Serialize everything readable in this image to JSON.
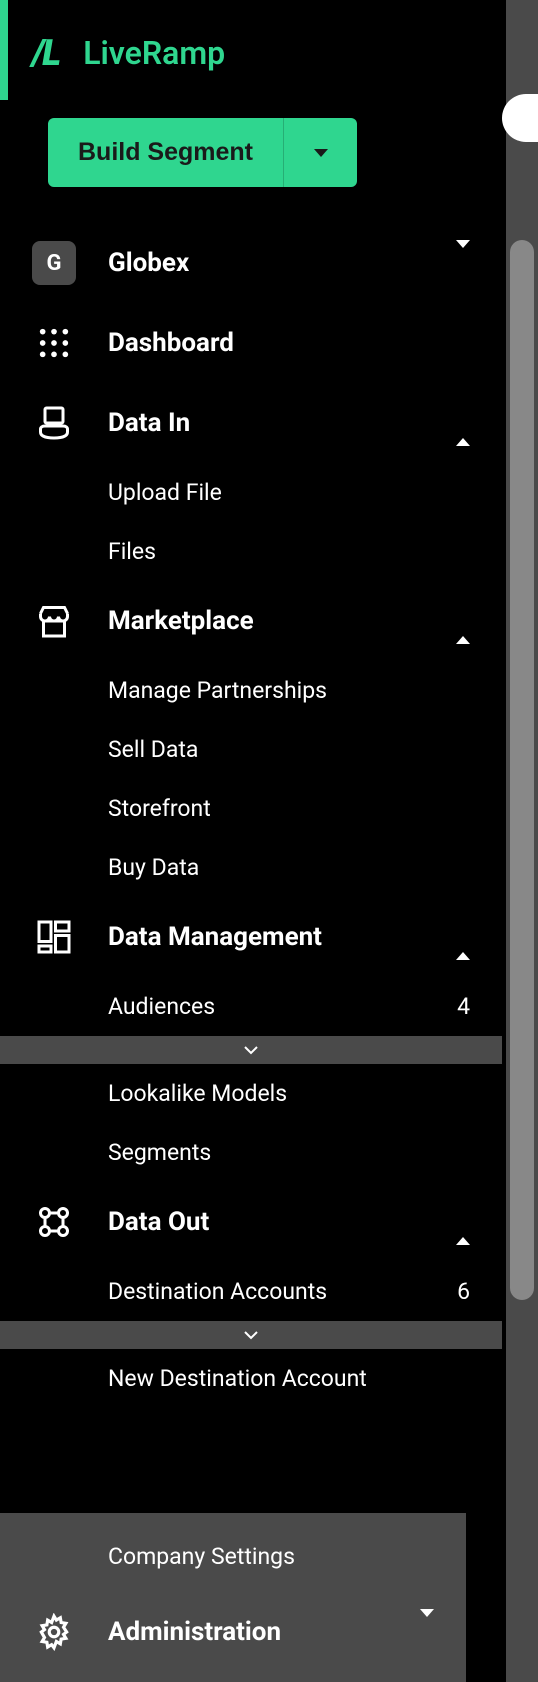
{
  "brand": "LiveRamp",
  "build_button": {
    "label": "Build Segment"
  },
  "org": {
    "badge": "G",
    "name": "Globex"
  },
  "nav": {
    "dashboard": "Dashboard",
    "data_in": {
      "label": "Data In",
      "items": [
        "Upload File",
        "Files"
      ]
    },
    "marketplace": {
      "label": "Marketplace",
      "items": [
        "Manage Partnerships",
        "Sell Data",
        "Storefront",
        "Buy Data"
      ]
    },
    "data_management": {
      "label": "Data Management",
      "audiences": {
        "label": "Audiences",
        "count": "4"
      },
      "items": [
        "Lookalike Models",
        "Segments"
      ]
    },
    "data_out": {
      "label": "Data Out",
      "dest_accounts": {
        "label": "Destination Accounts",
        "count": "6"
      },
      "items": [
        "New Destination Account"
      ]
    },
    "admin": {
      "company_settings": "Company Settings",
      "label": "Administration"
    }
  }
}
